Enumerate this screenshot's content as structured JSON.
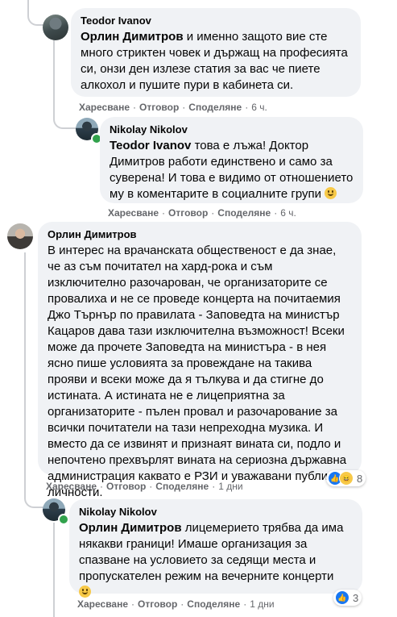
{
  "comments": [
    {
      "author": "Teodor Ivanov",
      "mention": "Орлин Димитров",
      "text": " и именно защото вие сте много стриктен човек и държащ на професията си, онзи ден излезе статия за вас че пиете алкохол и пушите пури в кабинета си.",
      "time": "6 ч."
    },
    {
      "author": "Nikolay Nikolov",
      "mention": "Teodor Ivanov",
      "text": " това е лъжа! Доктор Димитров работи единствено и само за суверена! И това е видимо от отношението му в коментарите в социалните групи",
      "emoji": "smile-emoji",
      "time": "6 ч."
    },
    {
      "author": "Орлин Димитров",
      "text": "В интерес на врачанската общественост е да знае, че аз съм почитател на хард-рока и съм изключително разочарован, че организаторите се провалиха и не се проведе концерта на почитаемия Джо Търнър по правилата - Заповедта на министър Кацаров дава тази изключителна възможност! Всеки може да прочете Заповедта на министъра - в нея ясно пише условията за провеждане на такива прояви и всеки може да я тълкува и да стигне до истината. А истината не е лицеприятна за организаторите - пълен провал и разочарование за всички почитатели на тази непреходна музика. И вместо да се извинят и признаят вината си, подло и непочтено прехвърлят вината на сериозна държавна администрация каквато е РЗИ и уважавани публични личности.",
      "time": "1 дни",
      "reaction_count": "8"
    },
    {
      "author": "Nikolay Nikolov",
      "mention": "Орлин Димитров",
      "text": " лицемерието трябва да има някакви граници! Имаше организация за спазване на условието за седящи места и пропускателен режим на вечерните концерти",
      "emoji": "smile-emoji",
      "time": "1 дни",
      "reaction_count": "3"
    }
  ],
  "actions": {
    "like": "Харесване",
    "reply": "Отговор",
    "share": "Споделяне",
    "dot": "·"
  }
}
